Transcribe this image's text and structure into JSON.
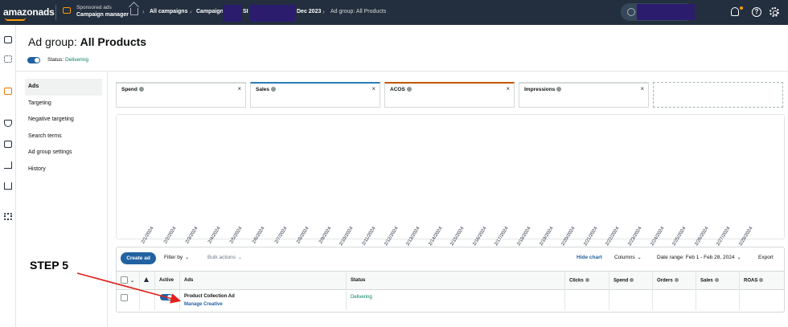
{
  "topbar": {
    "logo_text": "amazonads",
    "product_line1": "Sponsored ads",
    "product_line2": "Campaign manager",
    "crumb_all": "All campaigns",
    "crumb_campaign_prefix": "Campaign:",
    "crumb_campaign_mid": "SI",
    "crumb_campaign_suffix": "Dec 2023",
    "crumb_adgroup": "Ad group: All Products",
    "sep": "›",
    "help_glyph": "?"
  },
  "header": {
    "title_prefix": "Ad group:",
    "title_name": "All Products",
    "status_label": "Status:",
    "status_value": "Delivering"
  },
  "subnav": {
    "items": [
      "Ads",
      "Targeting",
      "Negative targeting",
      "Search terms",
      "Ad group settings",
      "History"
    ]
  },
  "metrics": [
    {
      "label": "Spend",
      "accent": "#d5d9d9"
    },
    {
      "label": "Sales",
      "accent": "#2d7bb4"
    },
    {
      "label": "ACOS",
      "accent": "#c45500"
    },
    {
      "label": "Impressions",
      "accent": "#d5d9d9"
    }
  ],
  "close_glyph": "×",
  "chart_data": {
    "type": "line",
    "x": [
      "2/1/2024",
      "2/2/2024",
      "2/3/2024",
      "2/4/2024",
      "2/5/2024",
      "2/6/2024",
      "2/7/2024",
      "2/8/2024",
      "2/9/2024",
      "2/10/2024",
      "2/11/2024",
      "2/12/2024",
      "2/13/2024",
      "2/14/2024",
      "2/15/2024",
      "2/16/2024",
      "2/17/2024",
      "2/18/2024",
      "2/19/2024",
      "2/20/2024",
      "2/21/2024",
      "2/22/2024",
      "2/23/2024",
      "2/24/2024",
      "2/25/2024",
      "2/26/2024",
      "2/27/2024",
      "2/28/2024"
    ],
    "series": []
  },
  "toolbar": {
    "create_label": "Create ad",
    "filter_label": "Filter by",
    "bulk_label": "Bulk actions",
    "hide_chart_label": "Hide chart",
    "columns_label": "Columns",
    "date_range_label": "Date range: Feb 1 - Feb 28, 2024",
    "export_label": "Export",
    "chevron": "⌄"
  },
  "table": {
    "headers": {
      "active": "Active",
      "ads": "Ads",
      "status": "Status",
      "clicks": "Clicks",
      "spend": "Spend",
      "orders": "Orders",
      "sales": "Sales",
      "roas": "ROAS"
    },
    "rows": [
      {
        "ad_name": "Product Collection Ad",
        "ad_link": "Manage Creative",
        "status": "Delivering"
      }
    ]
  },
  "annotation": {
    "step_label": "STEP 5",
    "arrow_color": "#e0201a"
  },
  "colors": {
    "topbar_bg": "#232f3e",
    "accent_orange": "#ff9900",
    "primary_blue": "#2162a1",
    "delivering_green": "#067d62"
  }
}
